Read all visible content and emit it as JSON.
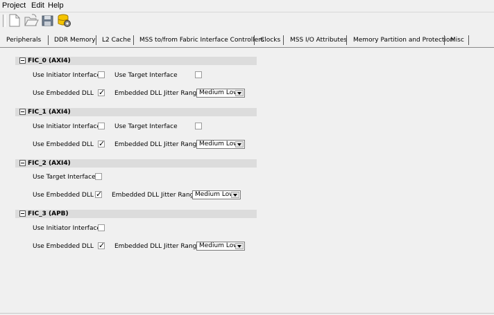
{
  "menu": [
    "Project",
    "Edit",
    "Help"
  ],
  "toolbar": {
    "icons": [
      "new-file-icon",
      "open-folder-icon",
      "save-icon",
      "database-settings-icon"
    ]
  },
  "tabs": [
    "Peripherals",
    "DDR Memory",
    "L2 Cache",
    "MSS to/from Fabric Interface Controllers",
    "Clocks",
    "MSS I/O Attributes",
    "Memory Partition and Protection",
    "Misc"
  ],
  "active_tab": "MSS to/from Fabric Interface Controllers",
  "sections": [
    {
      "title": "FIC_0 (AXI4)",
      "use_initiator_label": "Use Initiator Interface",
      "use_initiator_checked": false,
      "use_target_label": "Use Target Interface",
      "use_target_checked": false,
      "use_dll_label": "Use Embedded DLL",
      "use_dll_checked": true,
      "jitter_label": "Embedded DLL Jitter Range",
      "jitter_value": "Medium Low"
    },
    {
      "title": "FIC_1 (AXI4)",
      "use_initiator_label": "Use Initiator Interface",
      "use_initiator_checked": false,
      "use_target_label": "Use Target Interface",
      "use_target_checked": false,
      "use_dll_label": "Use Embedded DLL",
      "use_dll_checked": true,
      "jitter_label": "Embedded DLL Jitter Range",
      "jitter_value": "Medium Low"
    },
    {
      "title": "FIC_2 (AXI4)",
      "use_target_label": "Use Target Interface",
      "use_target_checked": false,
      "use_dll_label": "Use Embedded DLL",
      "use_dll_checked": true,
      "jitter_label": "Embedded DLL Jitter Range",
      "jitter_value": "Medium Low"
    },
    {
      "title": "FIC_3 (APB)",
      "use_initiator_label": "Use Initiator Interface",
      "use_initiator_checked": false,
      "use_dll_label": "Use Embedded DLL",
      "use_dll_checked": true,
      "jitter_label": "Embedded DLL Jitter Range",
      "jitter_value": "Medium Low"
    }
  ]
}
